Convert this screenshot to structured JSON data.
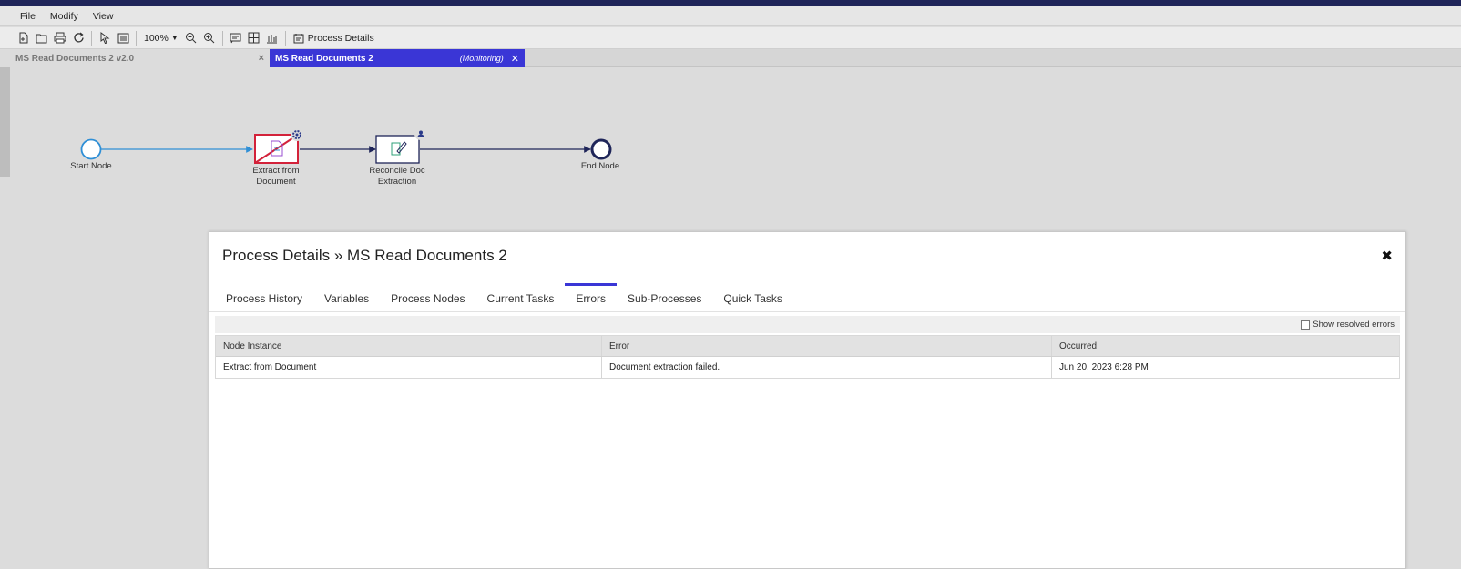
{
  "menu": [
    "File",
    "Modify",
    "View"
  ],
  "toolbar": {
    "zoom": "100%",
    "process_details_label": "Process Details"
  },
  "tabs": [
    {
      "title": "MS Read Documents 2 v2.0",
      "status": ""
    },
    {
      "title": "MS Read Documents 2",
      "status": "(Monitoring)"
    }
  ],
  "process": {
    "nodes": [
      {
        "label_line1": "Start Node",
        "label_line2": ""
      },
      {
        "label_line1": "Extract from",
        "label_line2": "Document"
      },
      {
        "label_line1": "Reconcile Doc",
        "label_line2": "Extraction"
      },
      {
        "label_line1": "End Node",
        "label_line2": ""
      }
    ]
  },
  "dialog": {
    "title": "Process Details » MS Read Documents 2",
    "tabs": [
      "Process History",
      "Variables",
      "Process Nodes",
      "Current Tasks",
      "Errors",
      "Sub-Processes",
      "Quick Tasks"
    ],
    "active_tab": "Errors",
    "show_resolved_label": "Show resolved errors",
    "columns": [
      "Node Instance",
      "Error",
      "Occurred"
    ],
    "rows": [
      {
        "node": "Extract from Document",
        "error": "Document extraction failed.",
        "occurred": "Jun 20, 2023 6:28 PM"
      }
    ]
  },
  "colors": {
    "accent": "#3a36d6",
    "flow_line": "#1f2559",
    "error_node": "#d3223a",
    "start_node": "#2f8fd6"
  }
}
